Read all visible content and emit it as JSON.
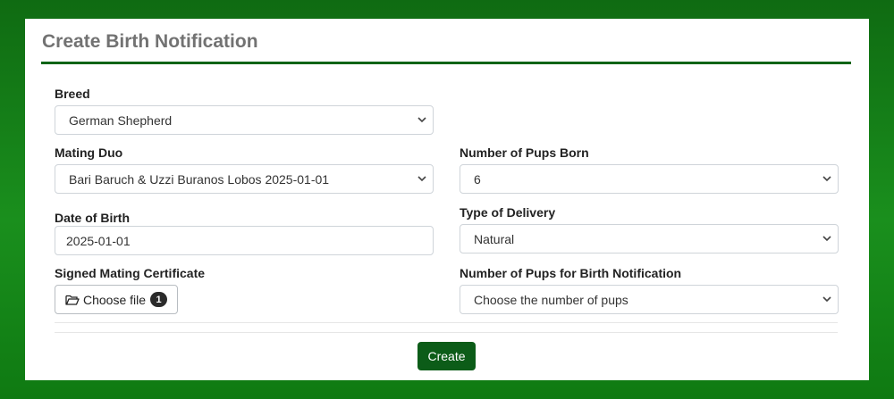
{
  "page": {
    "title": "Create Birth Notification",
    "accent_color": "#0c6416",
    "button_color": "#0c5c18"
  },
  "form": {
    "breed": {
      "label": "Breed",
      "value": "German Shepherd",
      "icon": "chevron-down-icon"
    },
    "mating_duo": {
      "label": "Mating Duo",
      "value": "Bari Baruch & Uzzi Buranos Lobos 2025-01-01",
      "icon": "chevron-down-icon"
    },
    "pups_born": {
      "label": "Number of Pups Born",
      "value": "6",
      "icon": "chevron-down-icon"
    },
    "date_of_birth": {
      "label": "Date of Birth",
      "value": "2025-01-01"
    },
    "delivery_type": {
      "label": "Type of Delivery",
      "value": "Natural",
      "icon": "chevron-down-icon"
    },
    "certificate": {
      "label": "Signed Mating Certificate",
      "button_label": "Choose file",
      "file_count": "1",
      "icon": "folder-open-icon"
    },
    "pups_notification": {
      "label": "Number of Pups for Birth Notification",
      "value": "Choose the number of pups",
      "icon": "chevron-down-icon"
    }
  },
  "actions": {
    "create_label": "Create"
  }
}
